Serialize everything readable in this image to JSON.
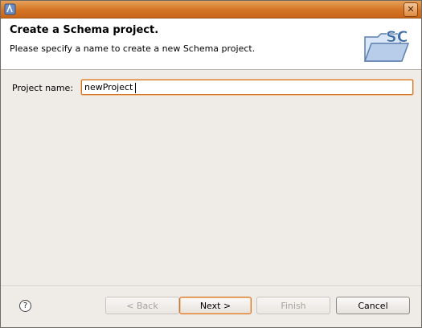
{
  "titlebar": {
    "title": "",
    "app_icon": "eclipse-icon",
    "close_label": "✕"
  },
  "header": {
    "title": "Create a Schema project.",
    "description": "Please specify a name to create a new Schema project.",
    "banner_icon": "schema-folder-icon",
    "banner_text": "SC"
  },
  "form": {
    "project_name_label": "Project name:",
    "project_name_value": "newProject"
  },
  "buttons": {
    "help": "?",
    "back": "< Back",
    "next": "Next >",
    "finish": "Finish",
    "cancel": "Cancel"
  },
  "colors": {
    "accent": "#d47424",
    "header_bg": "#ffffff",
    "body_bg": "#efebe7"
  }
}
